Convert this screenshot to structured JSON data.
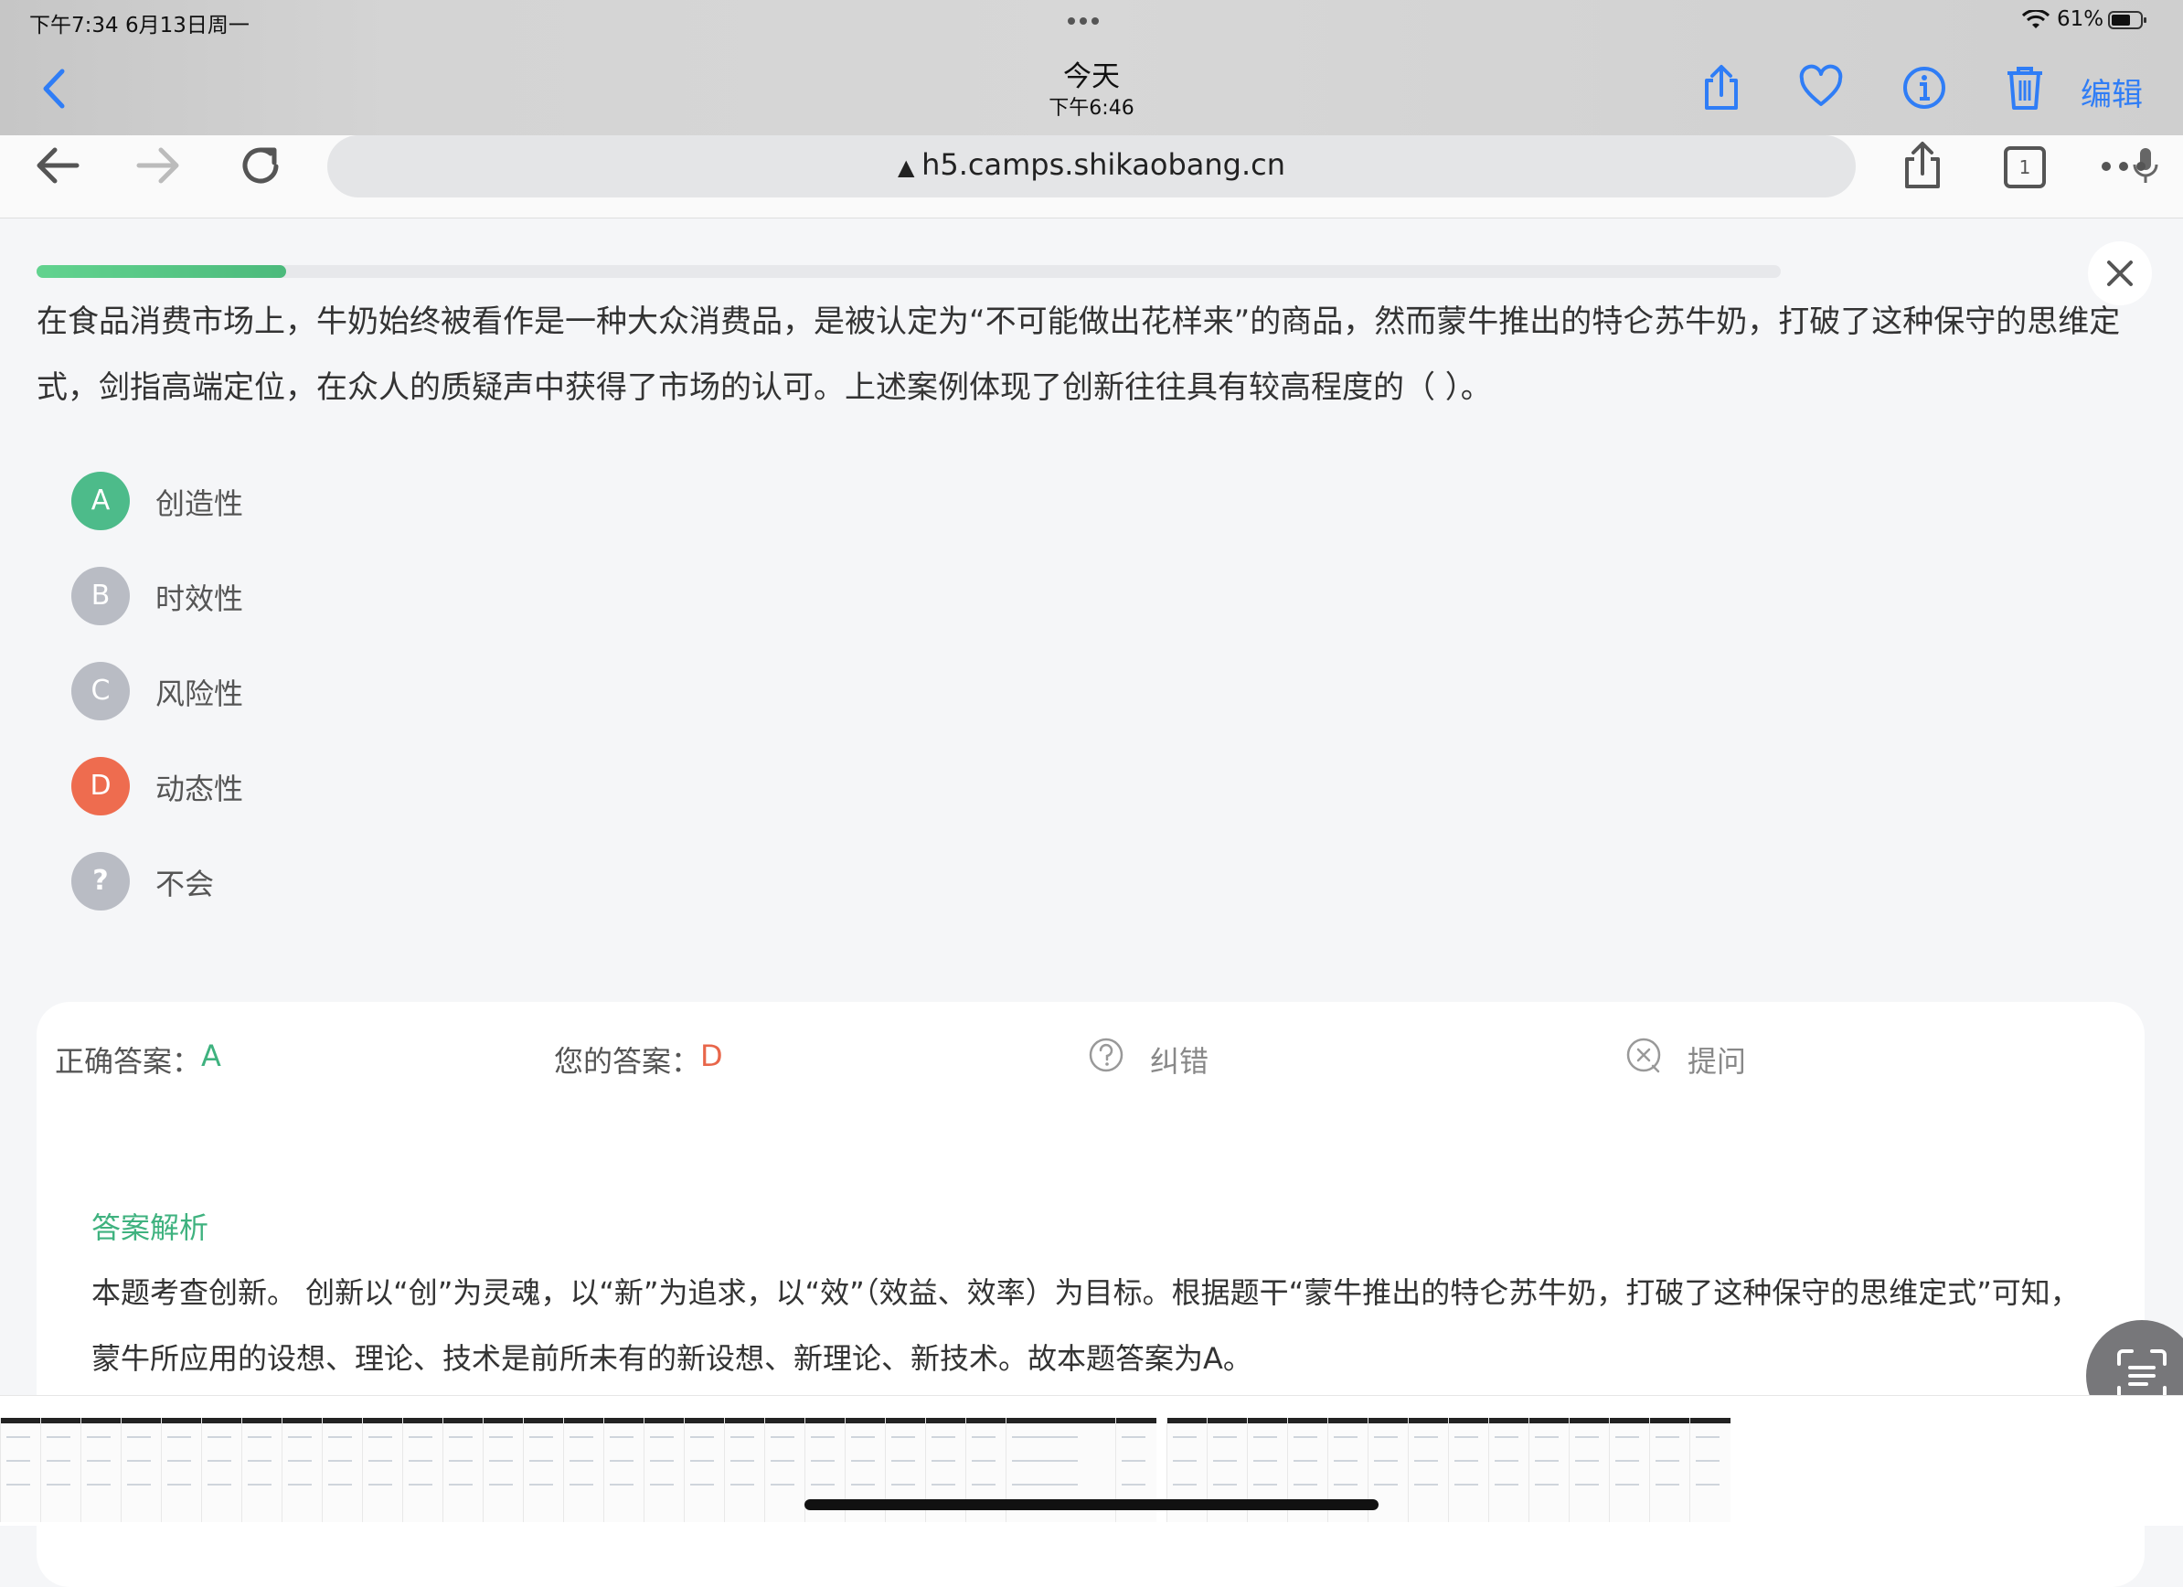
{
  "status_bar": {
    "time_date": "下午7:34   6月13日周一",
    "battery": "61%"
  },
  "photos_bar": {
    "title": "今天",
    "subtitle": "下午6:46",
    "edit_label": "编辑",
    "icons": [
      "back-icon",
      "share-icon",
      "heart-icon",
      "info-icon",
      "trash-icon"
    ]
  },
  "browser": {
    "url": "h5.camps.shikaobang.cn",
    "tab_count": "1",
    "icons": [
      "back-arrow-icon",
      "forward-arrow-icon",
      "reload-icon",
      "warning-icon",
      "mic-icon",
      "share-icon",
      "tabs-icon",
      "more-icon"
    ]
  },
  "quiz": {
    "progress": 0.143,
    "question": "在食品消费市场上，牛奶始终被看作是一种大众消费品，是被认定为“不可能做出花样来”的商品，然而蒙牛推出的特仑苏牛奶，打破了这种保守的思维定式，剑指高端定位，在众人的质疑声中获得了市场的认可。上述案例体现了创新往往具有较高程度的（ ）。",
    "options": [
      {
        "letter": "A",
        "text": "创造性",
        "state": "correct",
        "color": "#4dbb8a"
      },
      {
        "letter": "B",
        "text": "时效性",
        "state": "normal",
        "color": "#b9bcc4"
      },
      {
        "letter": "C",
        "text": "风险性",
        "state": "normal",
        "color": "#b9bcc4"
      },
      {
        "letter": "D",
        "text": "动态性",
        "state": "wrong",
        "color": "#ee6c4f"
      },
      {
        "letter": "?",
        "text": "不会",
        "state": "normal",
        "color": "#b9bcc4"
      }
    ]
  },
  "answer": {
    "correct_label": "正确答案：",
    "correct_value": "A",
    "yours_label": "您的答案：",
    "yours_value": "D",
    "correction_label": "纠错",
    "ask_label": "提问",
    "analysis_title": "答案解析",
    "analysis_text": "本题考查创新。 创新以“创”为灵魂，以“新”为追求，以“效”（效益、效率）为目标。根据题干“蒙牛推出的特仑苏牛奶，打破了这种保守的思维定式”可知，蒙牛所应用的设想、理论、技术是前所未有的新设想、新理论、新技术。故本题答案为A。"
  },
  "colors": {
    "accent_green": "#3fb27f",
    "wrong_red": "#e8664a",
    "ios_blue": "#2f7df6"
  }
}
